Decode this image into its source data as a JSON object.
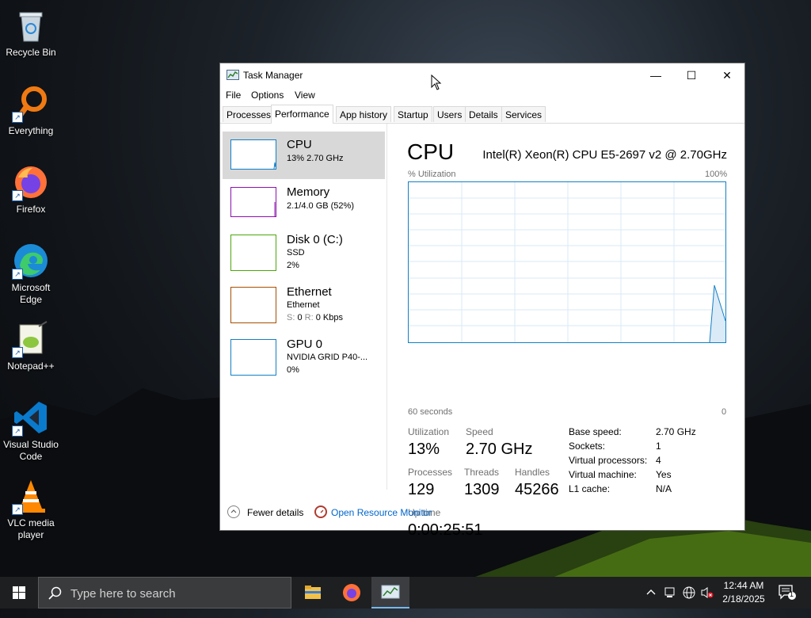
{
  "desktop": {
    "icons": [
      {
        "label": "Recycle Bin",
        "icon": "recycle-bin-icon"
      },
      {
        "label": "Everything",
        "icon": "everything-search-icon"
      },
      {
        "label": "Firefox",
        "icon": "firefox-icon"
      },
      {
        "label": "Microsoft Edge",
        "icon": "edge-icon"
      },
      {
        "label": "Notepad++",
        "icon": "notepadpp-icon"
      },
      {
        "label": "Visual Studio Code",
        "icon": "vscode-icon"
      },
      {
        "label": "VLC media player",
        "icon": "vlc-icon"
      }
    ]
  },
  "window": {
    "title": "Task Manager",
    "menu": [
      "File",
      "Options",
      "View"
    ],
    "tabs": [
      "Processes",
      "Performance",
      "App history",
      "Startup",
      "Users",
      "Details",
      "Services"
    ],
    "active_tab": "Performance"
  },
  "resources": [
    {
      "name": "CPU",
      "line1": "13%  2.70 GHz",
      "line2": "",
      "color": "#1280c4"
    },
    {
      "name": "Memory",
      "line1": "2.1/4.0 GB (52%)",
      "line2": "",
      "color": "#8b12ae"
    },
    {
      "name": "Disk 0 (C:)",
      "line1": "SSD",
      "line2": "2%",
      "color": "#4da60c"
    },
    {
      "name": "Ethernet",
      "line1": "Ethernet",
      "line2_s": "S:",
      "line2_sv": "0",
      "line2_r": "R:",
      "line2_rv": "0 Kbps",
      "color": "#a74f01"
    },
    {
      "name": "GPU 0",
      "line1": "NVIDIA GRID P40-...",
      "line2": "0%",
      "color": "#1280c4"
    }
  ],
  "cpu_detail": {
    "title": "CPU",
    "processor": "Intel(R) Xeon(R) CPU E5-2697 v2 @ 2.70GHz",
    "graph_label_left": "% Utilization",
    "graph_label_right": "100%",
    "graph_axis_left": "60 seconds",
    "graph_axis_right": "0",
    "utilization_label": "Utilization",
    "utilization": "13%",
    "speed_label": "Speed",
    "speed": "2.70 GHz",
    "processes_label": "Processes",
    "processes": "129",
    "threads_label": "Threads",
    "threads": "1309",
    "handles_label": "Handles",
    "handles": "45266",
    "uptime_label": "Up time",
    "uptime": "0:00:25:51",
    "specs": [
      {
        "k": "Base speed:",
        "v": "2.70 GHz"
      },
      {
        "k": "Sockets:",
        "v": "1"
      },
      {
        "k": "Virtual processors:",
        "v": "4"
      },
      {
        "k": "Virtual machine:",
        "v": "Yes"
      },
      {
        "k": "L1 cache:",
        "v": "N/A"
      }
    ]
  },
  "footer": {
    "fewer_details": "Fewer details",
    "resource_monitor": "Open Resource Monitor"
  },
  "taskbar": {
    "search_placeholder": "Type here to search",
    "time": "12:44 AM",
    "date": "2/18/2025",
    "notification_count": "1"
  }
}
